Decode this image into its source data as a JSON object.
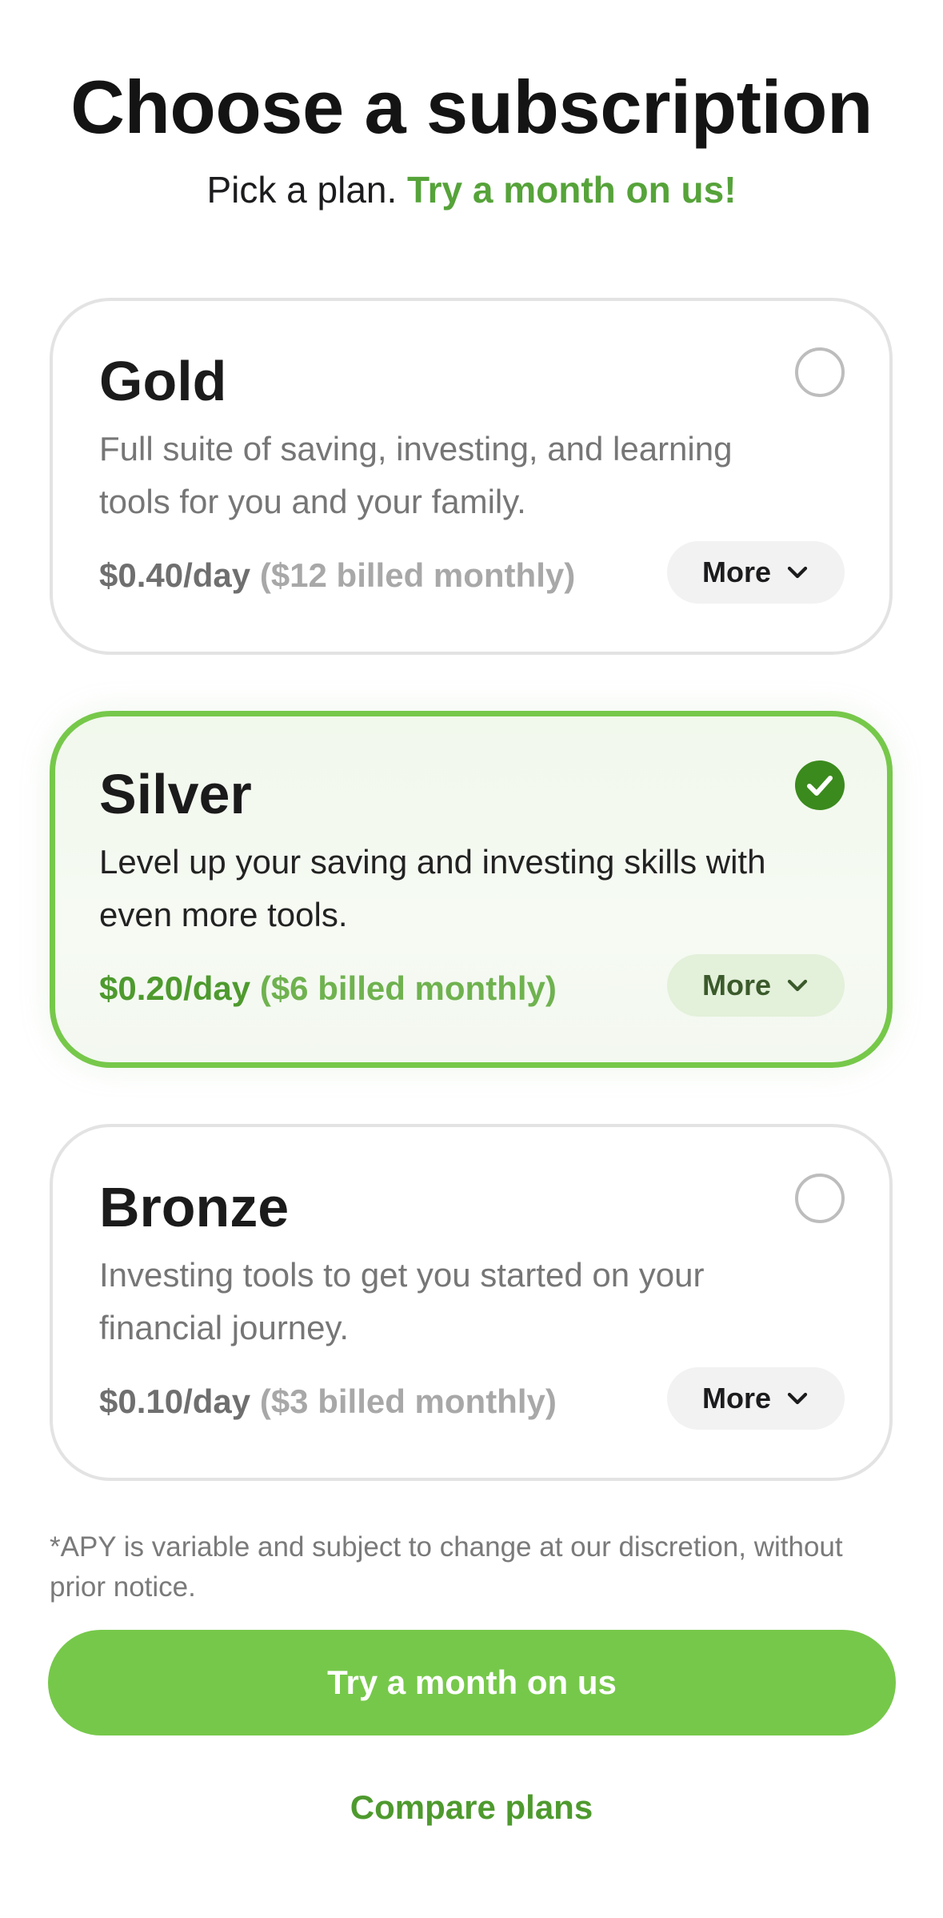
{
  "header": {
    "title": "Choose a subscription",
    "subtitle_lead": "Pick a plan.",
    "subtitle_accent": "Try a month on us!"
  },
  "plans": [
    {
      "name": "Gold",
      "description": "Full suite of saving, investing, and learning tools for you and your family.",
      "price_day": "$0.40/day",
      "price_billed": "($12 billed monthly)",
      "more_label": "More",
      "selected": false
    },
    {
      "name": "Silver",
      "description": "Level up your saving and investing skills with even more tools.",
      "price_day": "$0.20/day",
      "price_billed": "($6 billed monthly)",
      "more_label": "More",
      "selected": true
    },
    {
      "name": "Bronze",
      "description": "Investing tools to get you started on your financial journey.",
      "price_day": "$0.10/day",
      "price_billed": "($3 billed monthly)",
      "more_label": "More",
      "selected": false
    }
  ],
  "footer": {
    "disclaimer": "*APY is variable and subject to change at our discretion, without prior notice.",
    "cta_label": "Try a month on us",
    "compare_label": "Compare plans"
  },
  "icons": {
    "radio_unselected": "radio-empty-icon",
    "radio_selected": "check-circle-icon",
    "more_chevron": "chevron-down-icon"
  },
  "colors": {
    "accent": "#76c84a",
    "accent_text": "#4e9a2e",
    "selected_check": "#3b8a1d"
  }
}
